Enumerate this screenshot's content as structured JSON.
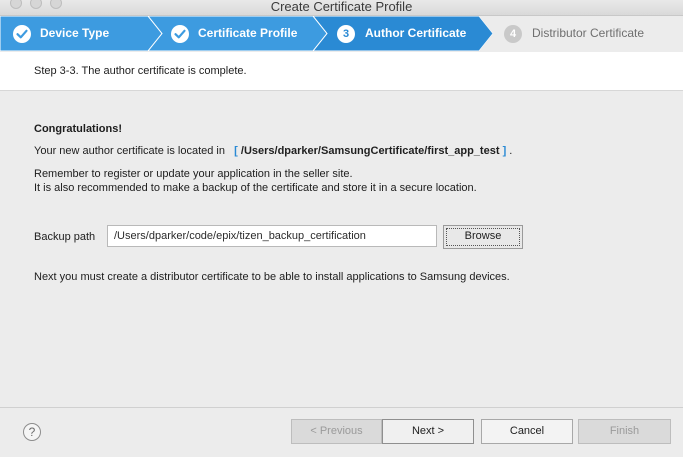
{
  "window": {
    "title": "Create Certificate Profile"
  },
  "steps": [
    {
      "number": "1",
      "label": "Device Type",
      "state": "done"
    },
    {
      "number": "2",
      "label": "Certificate Profile",
      "state": "done"
    },
    {
      "number": "3",
      "label": "Author Certificate",
      "state": "current"
    },
    {
      "number": "4",
      "label": "Distributor Certificate",
      "state": "todo"
    }
  ],
  "info": {
    "text": "Step 3-3. The author certificate is complete."
  },
  "main": {
    "heading": "Congratulations!",
    "location_prefix": "Your new author certificate is located in",
    "bracket_open": "[",
    "location_path": "/Users/dparker/SamsungCertificate/first_app_test",
    "bracket_close": "]",
    "location_suffix": ".",
    "reminder_line1": "Remember to register or update your application in the seller site.",
    "reminder_line2": "It is also recommended to make a backup of the certificate and store it in a secure location.",
    "backup_label": "Backup path",
    "backup_value": "/Users/dparker/code/epix/tizen_backup_certification",
    "browse_label": "Browse",
    "next_info": "Next you must create a distributor certificate to be able to install applications to Samsung devices."
  },
  "footer": {
    "help_label": "?",
    "previous_label": "< Previous",
    "next_label": "Next >",
    "cancel_label": "Cancel",
    "finish_label": "Finish"
  },
  "colors": {
    "step_done": "#3d9be0",
    "step_current": "#2a8ad4",
    "step_todo": "#ececec",
    "accent": "#2a8ad4"
  }
}
